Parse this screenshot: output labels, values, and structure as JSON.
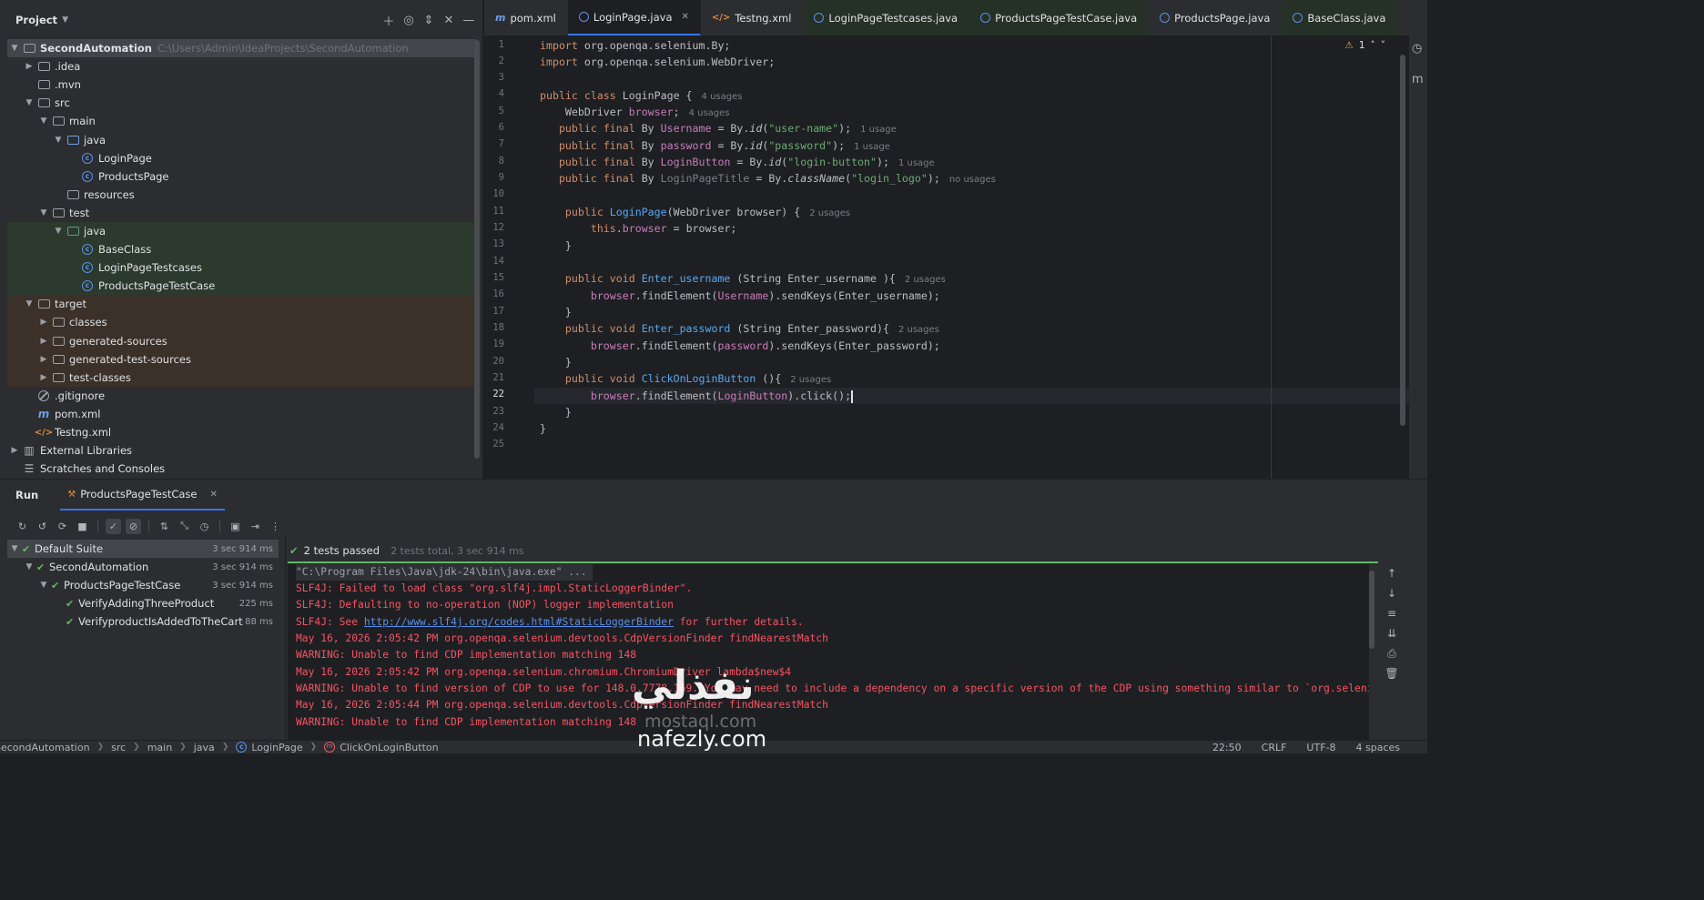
{
  "project": {
    "title": "Project",
    "tree": [
      {
        "label": "SecondAutomation",
        "path": "C:\\Users\\Admin\\IdeaProjects\\SecondAutomation"
      },
      {
        "label": ".idea"
      },
      {
        "label": ".mvn"
      },
      {
        "label": "src"
      },
      {
        "label": "main"
      },
      {
        "label": "java"
      },
      {
        "label": "LoginPage"
      },
      {
        "label": "ProductsPage"
      },
      {
        "label": "resources"
      },
      {
        "label": "test"
      },
      {
        "label": "java"
      },
      {
        "label": "BaseClass"
      },
      {
        "label": "LoginPageTestcases"
      },
      {
        "label": "ProductsPageTestCase"
      },
      {
        "label": "target"
      },
      {
        "label": "classes"
      },
      {
        "label": "generated-sources"
      },
      {
        "label": "generated-test-sources"
      },
      {
        "label": "test-classes"
      },
      {
        "label": ".gitignore"
      },
      {
        "label": "pom.xml"
      },
      {
        "label": "Testng.xml"
      },
      {
        "label": "External Libraries"
      },
      {
        "label": "Scratches and Consoles"
      }
    ]
  },
  "tabs": [
    {
      "label": "pom.xml"
    },
    {
      "label": "LoginPage.java"
    },
    {
      "label": "Testng.xml"
    },
    {
      "label": "LoginPageTestcases.java"
    },
    {
      "label": "ProductsPageTestCase.java"
    },
    {
      "label": "ProductsPage.java"
    },
    {
      "label": "BaseClass.java"
    }
  ],
  "editor": {
    "warning_count": "1",
    "line_numbers": [
      "1",
      "2",
      "3",
      "4",
      "5",
      "6",
      "7",
      "8",
      "9",
      "10",
      "11",
      "12",
      "13",
      "14",
      "15",
      "16",
      "17",
      "18",
      "19",
      "20",
      "21",
      "22",
      "23",
      "24",
      "25"
    ],
    "current_line": "22",
    "hints": {
      "h4": "4 usages",
      "h5": "4 usages",
      "h6": "1 usage",
      "h7": "1 usage",
      "h8": "1 usage",
      "h9": "no usages",
      "h11": "2 usages",
      "h15": "2 usages",
      "h18": "2 usages",
      "h21": "2 usages"
    }
  },
  "run": {
    "title": "Run",
    "tab_label": "ProductsPageTestCase",
    "tests": [
      {
        "name": "Default Suite",
        "time": "3 sec 914 ms"
      },
      {
        "name": "SecondAutomation",
        "time": "3 sec 914 ms"
      },
      {
        "name": "ProductsPageTestCase",
        "time": "3 sec 914 ms"
      },
      {
        "name": "VerifyAddingThreeProduct",
        "time": "225 ms"
      },
      {
        "name": "VerifyproductIsAddedToTheCart",
        "time": "88 ms"
      }
    ],
    "status": "2 tests passed",
    "summary": "2 tests total, 3 sec 914 ms",
    "console": [
      "\"C:\\Program Files\\Java\\jdk-24\\bin\\java.exe\" ...",
      "SLF4J: Failed to load class \"org.slf4j.impl.StaticLoggerBinder\".",
      "SLF4J: Defaulting to no-operation (NOP) logger implementation",
      "SLF4J: See ",
      "http://www.slf4j.org/codes.html#StaticLoggerBinder",
      " for further details.",
      "May 16, 2026 2:05:42 PM org.openqa.selenium.devtools.CdpVersionFinder findNearestMatch",
      "WARNING: Unable to find CDP implementation matching 148",
      "May 16, 2026 2:05:42 PM org.openqa.selenium.chromium.ChromiumDriver lambda$new$4",
      "WARNING: Unable to find version of CDP to use for 148.0.7778.169. You may need to include a dependency on a specific version of the CDP using something similar to `org.seleniumhq",
      "May 16, 2026 2:05:44 PM org.openqa.selenium.devtools.CdpVersionFinder findNearestMatch",
      "WARNING: Unable to find CDP implementation matching 148"
    ]
  },
  "status_bar": {
    "crumbs": [
      "SecondAutomation",
      "src",
      "main",
      "java",
      "LoginPage",
      "ClickOnLoginButton"
    ],
    "position": "22:50",
    "line_sep": "CRLF",
    "encoding": "UTF-8",
    "indent": "4 spaces"
  },
  "watermark": {
    "arabic": "نفذلي",
    "site1": "mostaql.com",
    "site2": "nafezly.com"
  },
  "colors": {
    "accent": "#3574f0",
    "pass_green": "#5fb865",
    "error_red": "#f75464"
  }
}
